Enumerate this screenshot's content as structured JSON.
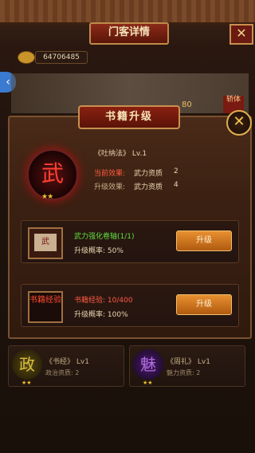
{
  "header": {
    "title": "门客详情",
    "close": "✕"
  },
  "currency": {
    "amount": "64706485"
  },
  "background_scene": {
    "number": "80",
    "seal": "轿体"
  },
  "dialog": {
    "title": "书籍升级",
    "close": "✕",
    "book": {
      "emblem_char": "武",
      "stars": "★★",
      "name": "《吐纳法》 Lv.1",
      "current_label": "当前效果:",
      "current_attr": "武力资质",
      "current_value": "2",
      "upgrade_label": "升级效果:",
      "upgrade_attr": "武力资质",
      "upgrade_value": "4"
    },
    "items": [
      {
        "icon_text": "武",
        "line1": "武力强化卷轴(1/1)",
        "line2": "升级概率: 50%",
        "button": "升级"
      },
      {
        "icon_text": "书籍经验",
        "line1_label": "书籍经验: ",
        "line1_value": "10/400",
        "line2": "升级概率: 100%",
        "button": "升级"
      }
    ]
  },
  "cards": [
    {
      "emblem": "政",
      "name": "《书经》 Lv1",
      "sub": "政治资质: 2",
      "stars": "★★",
      "color": "#8a7a20"
    },
    {
      "emblem": "魅",
      "name": "《周礼》 Lv1",
      "sub": "魅力资质: 2",
      "stars": "★★",
      "color": "#6a2a8a"
    }
  ]
}
